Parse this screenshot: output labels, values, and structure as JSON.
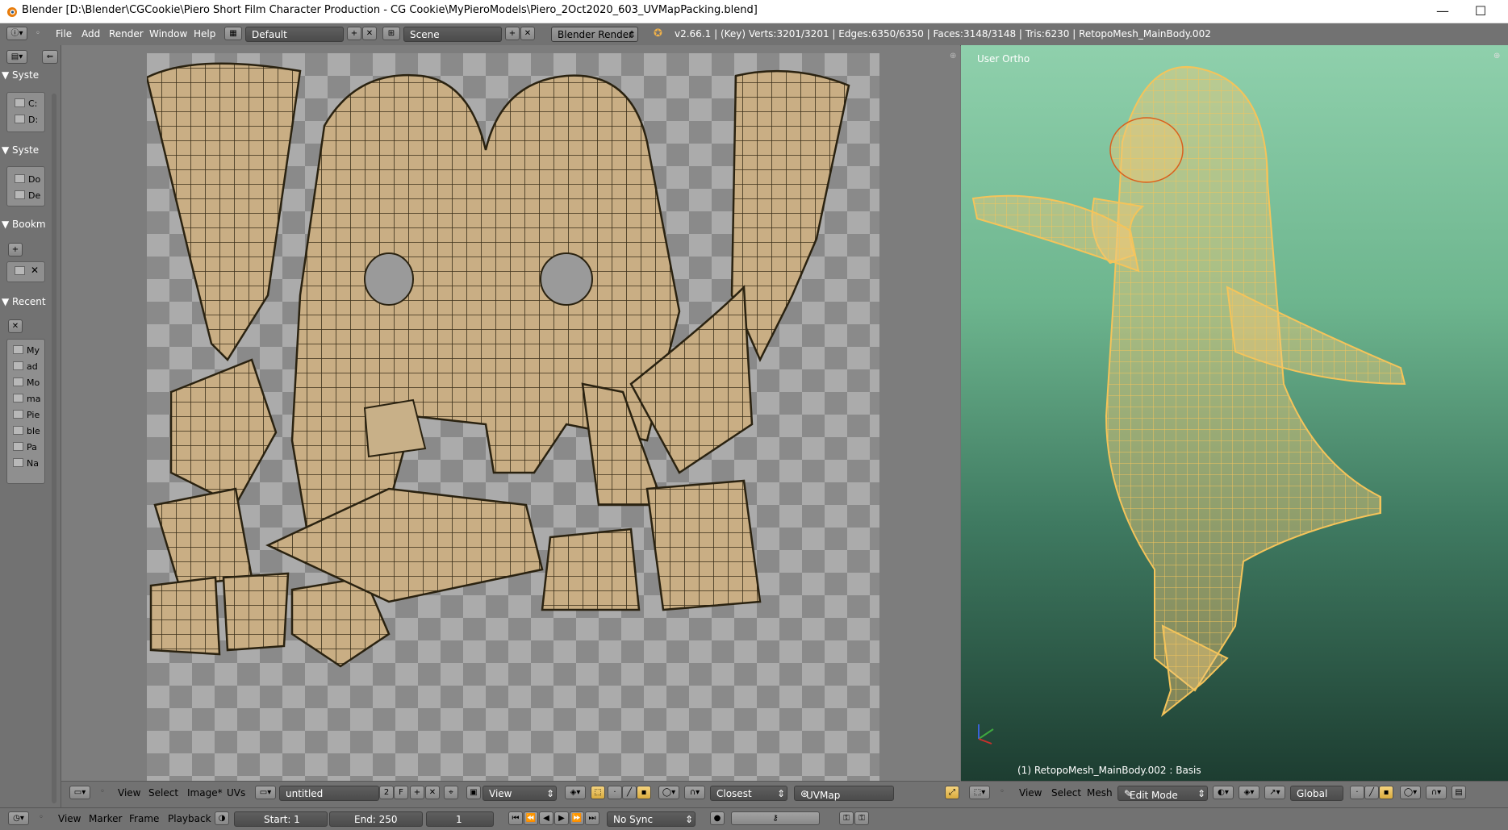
{
  "window": {
    "title": "Blender [D:\\Blender\\CGCookie\\Piero Short Film Character Production - CG Cookie\\MyPieroModels\\Piero_2Oct2020_603_UVMapPacking.blend]",
    "minimize": "—",
    "maximize": "☐"
  },
  "info": {
    "menus": [
      "File",
      "Add",
      "Render",
      "Window",
      "Help"
    ],
    "screen_layout": "Default",
    "scene": "Scene",
    "render_engine": "Blender Render",
    "stats": "v2.66.1 | (Key) Verts:3201/3201 | Edges:6350/6350 | Faces:3148/3148 | Tris:6230 | RetopoMesh_MainBody.002"
  },
  "filebrowser": {
    "sections": [
      {
        "title": "Syste",
        "items": [
          "C:",
          "D:"
        ]
      },
      {
        "title": "Syste",
        "items": [
          "Do",
          "De"
        ]
      },
      {
        "title": "Bookm",
        "items": []
      },
      {
        "title": "Recent",
        "items": [
          "My",
          "ad",
          "Mo",
          "ma",
          "Pie",
          "ble",
          "Pa",
          "Na"
        ]
      }
    ]
  },
  "uv_editor": {
    "menus": [
      "View",
      "Select",
      "Image*",
      "UVs"
    ],
    "image_name": "untitled",
    "users_count": "2",
    "fake_user": "F",
    "view_mode": "View",
    "sticky_mode": "Closest",
    "uv_map": "UVMap"
  },
  "viewport": {
    "view_label": "User Ortho",
    "object_label": "(1) RetopoMesh_MainBody.002 : Basis",
    "menus": [
      "View",
      "Select",
      "Mesh"
    ],
    "mode": "Edit Mode",
    "orientation": "Global"
  },
  "timeline": {
    "menus": [
      "View",
      "Marker",
      "Frame",
      "Playback"
    ],
    "start": "Start: 1",
    "end": "End: 250",
    "current": "1",
    "sync": "No Sync"
  },
  "colors": {
    "accent": "#e7b04a",
    "wire": "#f5c45a",
    "uv_island": "#c8b088"
  }
}
